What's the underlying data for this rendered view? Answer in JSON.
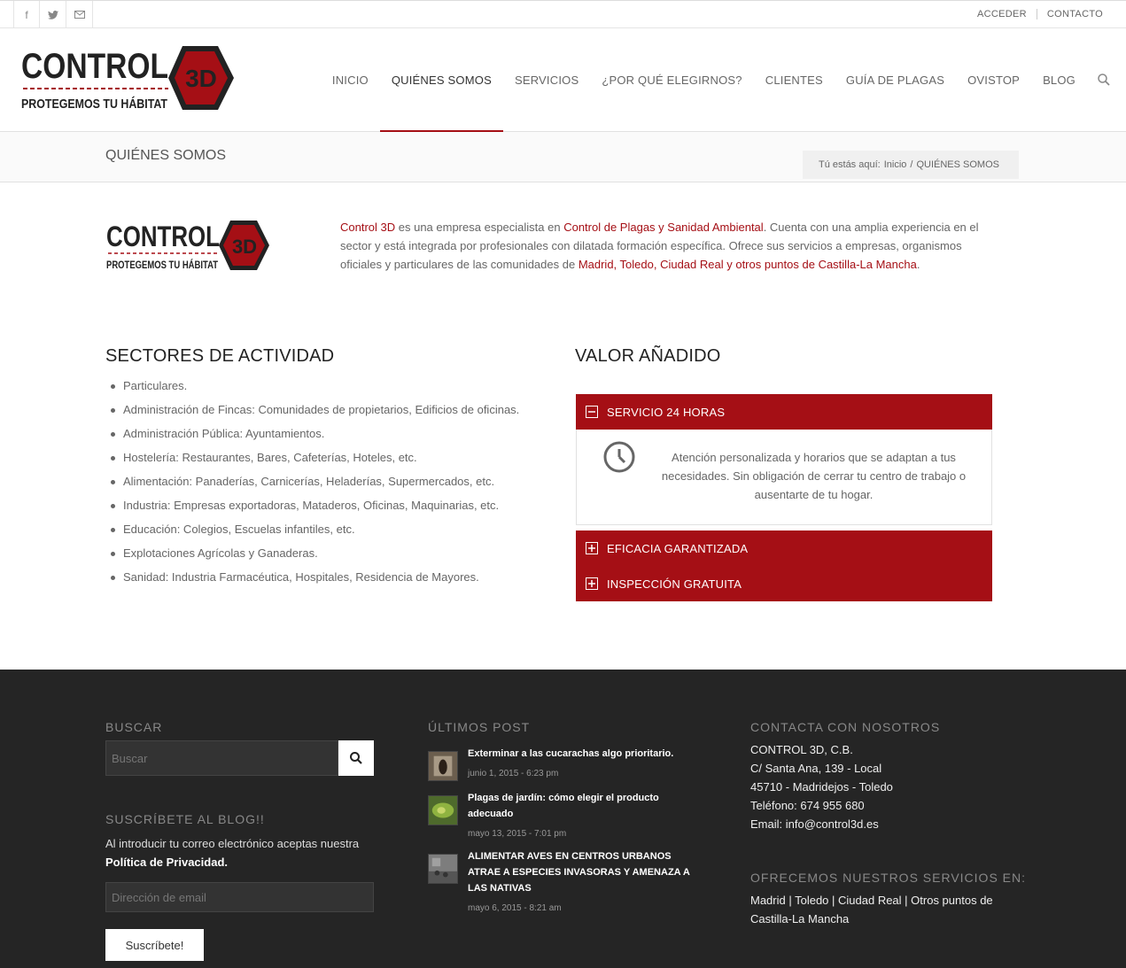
{
  "topbar": {
    "social": [
      {
        "icon": "facebook-icon",
        "glyph": "f"
      },
      {
        "icon": "twitter-icon",
        "glyph": "🐦"
      },
      {
        "icon": "mail-icon",
        "glyph": "✉"
      }
    ],
    "links": [
      "ACCEDER",
      "CONTACTO"
    ]
  },
  "logo": {
    "brand": "CONTROL",
    "mark": "3D",
    "tagline": "PROTEGEMOS TU HÁBITAT"
  },
  "nav": {
    "items": [
      "INICIO",
      "QUIÉNES SOMOS",
      "SERVICIOS",
      "¿POR QUÉ ELEGIRNOS?",
      "CLIENTES",
      "GUÍA DE PLAGAS",
      "OVISTOP",
      "BLOG"
    ],
    "active": "QUIÉNES SOMOS"
  },
  "titlebar": {
    "title": "QUIÉNES SOMOS",
    "breadcrumb_label": "Tú estás aquí:",
    "breadcrumb_home": "Inicio",
    "breadcrumb_sep": "/",
    "breadcrumb_current": "QUIÉNES SOMOS"
  },
  "intro": {
    "company": "Control 3D",
    "t1": " es una empresa especialista en ",
    "specialty": "Control de Plagas y Sanidad Ambiental",
    "t2": ". Cuenta con una amplia experiencia en el sector y está integrada por profesionales con dilatada formación específica. Ofrece sus servicios a empresas, organismos oficiales y particulares de las comunidades de ",
    "places": "Madrid, Toledo, Ciudad Real y otros puntos de Castilla-La Mancha",
    "t3": "."
  },
  "sectors": {
    "heading": "SECTORES DE ACTIVIDAD",
    "items": [
      "Particulares.",
      "Administración de Fincas: Comunidades de propietarios, Edificios de oficinas.",
      "Administración Pública: Ayuntamientos.",
      "Hostelería: Restaurantes, Bares, Cafeterías, Hoteles, etc.",
      "Alimentación: Panaderías, Carnicerías, Heladerías, Supermercados, etc.",
      "Industria: Empresas exportadoras, Mataderos, Oficinas, Maquinarias, etc.",
      "Educación: Colegios, Escuelas infantiles, etc.",
      "Explotaciones Agrícolas y Ganaderas.",
      "Sanidad: Industria Farmacéutica, Hospitales, Residencia de Mayores."
    ]
  },
  "value": {
    "heading": "VALOR AÑADIDO",
    "panels": [
      {
        "title": "SERVICIO 24 HORAS",
        "icon": "minus",
        "body": "Atención personalizada y horarios que se adaptan a tus necesidades. Sin obligación de cerrar tu centro de trabajo o ausentarte de tu hogar."
      },
      {
        "title": "EFICACIA GARANTIZADA",
        "icon": "plus"
      },
      {
        "title": "INSPECCIÓN GRATUITA",
        "icon": "plus"
      }
    ]
  },
  "footer": {
    "search_heading": "BUSCAR",
    "search_placeholder": "Buscar",
    "subscribe_heading": "SUSCRÍBETE AL BLOG!!",
    "subscribe_text": "Al introducir tu correo electrónico aceptas nuestra ",
    "privacy_link": "Política de Privacidad.",
    "email_placeholder": "Dirección de email",
    "subscribe_button": "Suscríbete!",
    "posts_heading": "ÚLTIMOS POST",
    "posts": [
      {
        "title": "Exterminar a las cucarachas algo prioritario.",
        "date": "junio 1, 2015 - 6:23 pm"
      },
      {
        "title": "Plagas de jardín: cómo elegir el producto adecuado",
        "date": "mayo 13, 2015 - 7:01 pm"
      },
      {
        "title": "ALIMENTAR AVES EN CENTROS URBANOS ATRAE A ESPECIES INVASORAS Y AMENAZA A LAS NATIVAS",
        "date": "mayo 6, 2015 - 8:21 am"
      }
    ],
    "contact_heading": "CONTACTA CON NOSOTROS",
    "contact_lines": [
      "CONTROL 3D, C.B.",
      "C/ Santa Ana, 139 - Local",
      "45710 - Madridejos - Toledo",
      "Teléfono: 674 955 680",
      "Email: info@control3d.es"
    ],
    "areas_heading": "OFRECEMOS NUESTROS SERVICIOS EN:",
    "areas_text": "Madrid | Toledo | Ciudad Real | Otros puntos de Castilla-La Mancha"
  },
  "colors": {
    "accent": "#a50f15",
    "footer_bg": "#252525",
    "dark_logo": "#222222"
  }
}
